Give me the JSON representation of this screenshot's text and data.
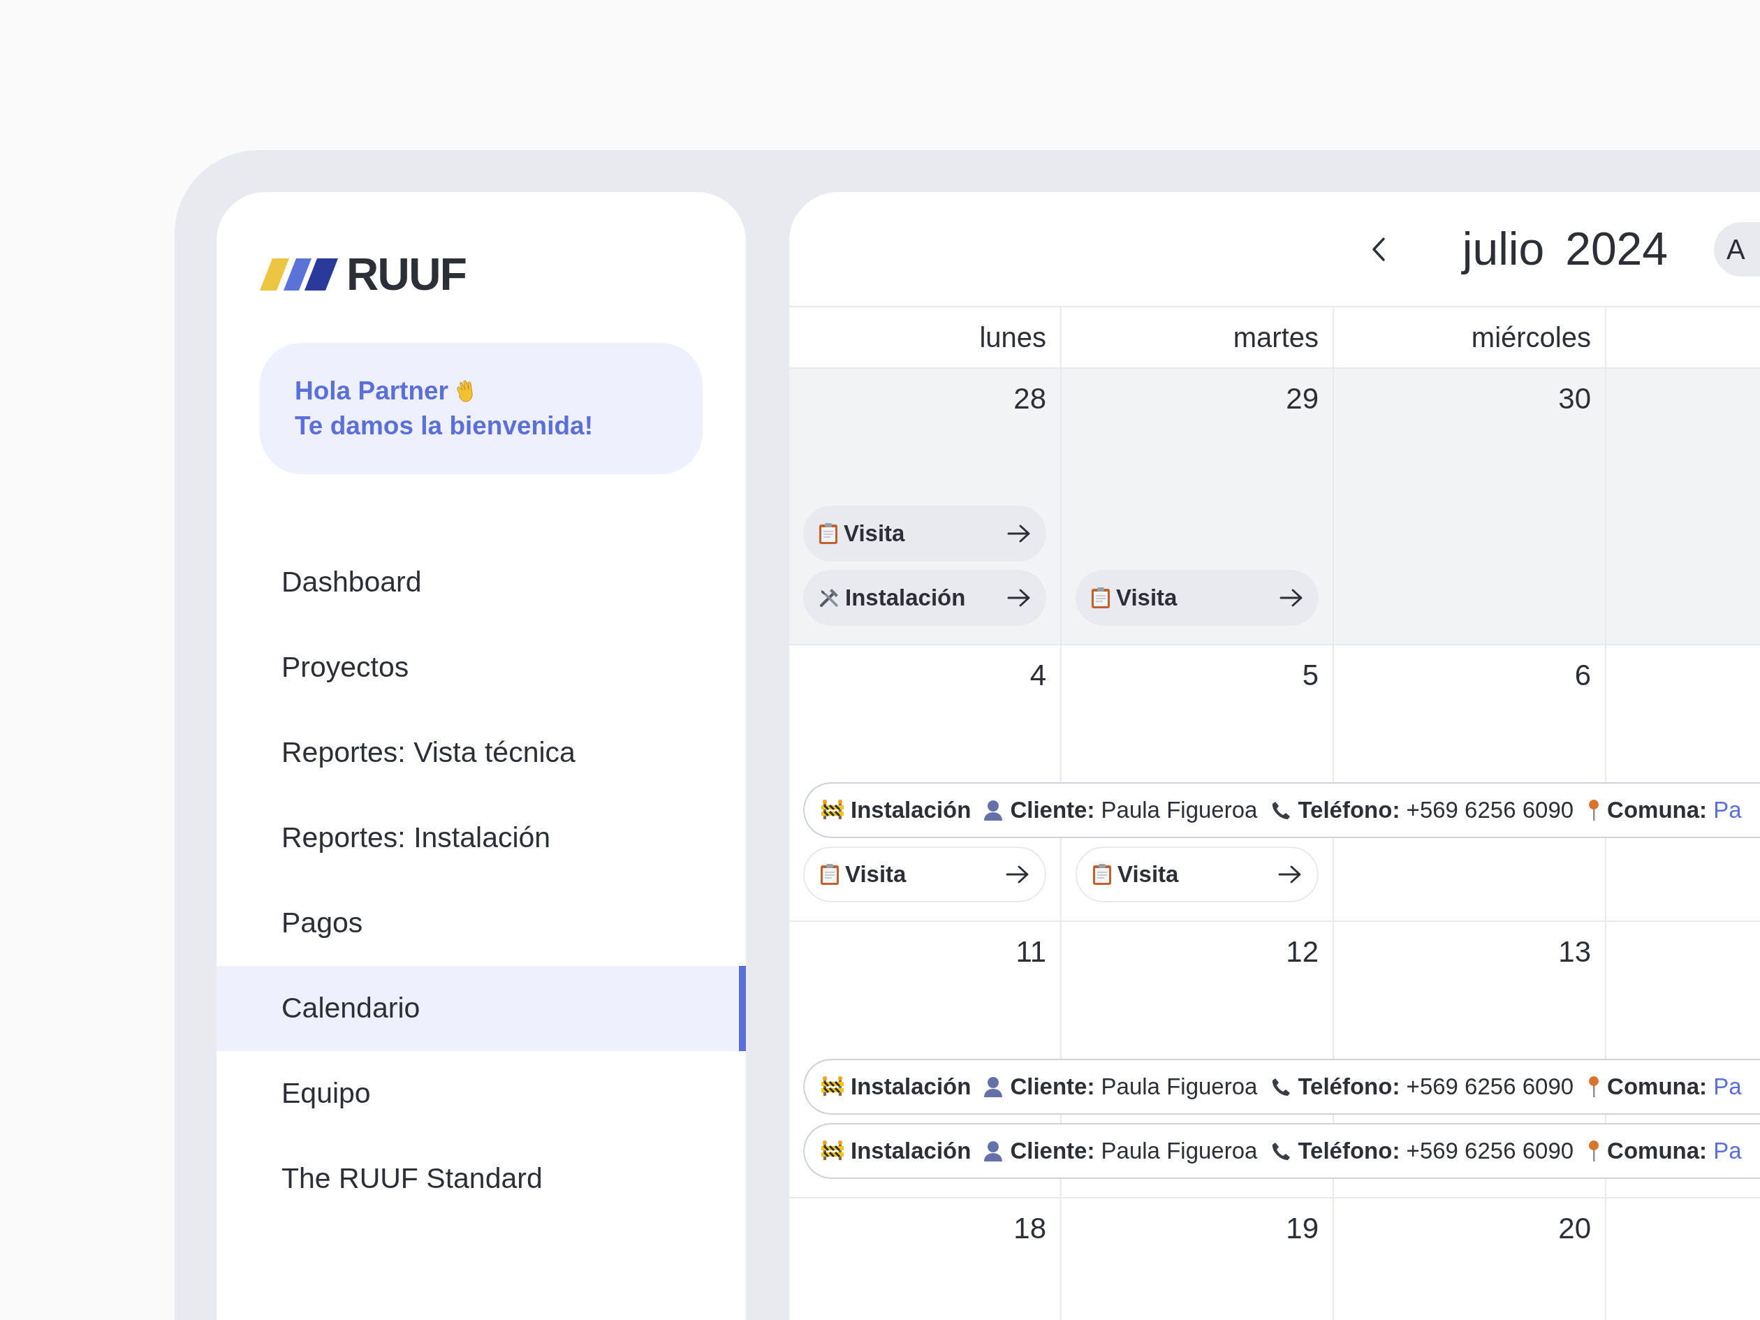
{
  "sidebar": {
    "logo": {
      "text": "RUUF"
    },
    "greeting": {
      "line_1": "Hola Partner",
      "line_2": "Te damos la bienvenida!"
    },
    "items": [
      {
        "label": "Dashboard",
        "selected": false
      },
      {
        "label": "Proyectos",
        "selected": false
      },
      {
        "label": "Reportes: Vista técnica",
        "selected": false
      },
      {
        "label": "Reportes: Instalación",
        "selected": false
      },
      {
        "label": "Pagos",
        "selected": false
      },
      {
        "label": "Calendario",
        "selected": true
      },
      {
        "label": "Equipo",
        "selected": false
      },
      {
        "label": "The RUUF Standard",
        "selected": false
      }
    ]
  },
  "calendar": {
    "month": "julio",
    "year": "2024",
    "today_button": "A",
    "weekdays": [
      "lunes",
      "martes",
      "miércoles"
    ],
    "weeks": [
      {
        "outside_month": true,
        "days": [
          {
            "number": "28",
            "events": [
              {
                "kind": "visit",
                "label": "Visita"
              },
              {
                "kind": "installation",
                "label": "Instalación"
              }
            ]
          },
          {
            "number": "29",
            "events": [
              {
                "kind": "visit",
                "label": "Visita"
              }
            ]
          },
          {
            "number": "30"
          }
        ]
      },
      {
        "outside_month": false,
        "days": [
          {
            "number": "4",
            "events": [
              {
                "kind": "detail",
                "label": "Instalación",
                "fields": [
                  {
                    "kind": "client",
                    "label": "Cliente:",
                    "value": "Paula Figueroa"
                  },
                  {
                    "kind": "phone",
                    "label": "Teléfono:",
                    "value": "+569 6256 6090"
                  },
                  {
                    "kind": "place",
                    "label": "Comuna:",
                    "value": "Pa"
                  }
                ]
              },
              {
                "kind": "visit",
                "label": "Visita"
              }
            ]
          },
          {
            "number": "5",
            "events": [
              {
                "kind": "visit",
                "label": "Visita"
              }
            ]
          },
          {
            "number": "6"
          }
        ]
      },
      {
        "outside_month": false,
        "days": [
          {
            "number": "11",
            "events": [
              {
                "kind": "detail",
                "label": "Instalación",
                "fields": [
                  {
                    "kind": "client",
                    "label": "Cliente:",
                    "value": "Paula Figueroa"
                  },
                  {
                    "kind": "phone",
                    "label": "Teléfono:",
                    "value": "+569 6256 6090"
                  },
                  {
                    "kind": "place",
                    "label": "Comuna:",
                    "value": "Pa"
                  }
                ]
              },
              {
                "kind": "detail",
                "label": "Instalación",
                "fields": [
                  {
                    "kind": "client",
                    "label": "Cliente:",
                    "value": "Paula Figueroa"
                  },
                  {
                    "kind": "phone",
                    "label": "Teléfono:",
                    "value": "+569 6256 6090"
                  },
                  {
                    "kind": "place",
                    "label": "Comuna:",
                    "value": "Pa"
                  }
                ]
              }
            ]
          },
          {
            "number": "12"
          },
          {
            "number": "13"
          }
        ]
      },
      {
        "outside_month": false,
        "days": [
          {
            "number": "18"
          },
          {
            "number": "19"
          },
          {
            "number": "20"
          }
        ]
      }
    ]
  }
}
